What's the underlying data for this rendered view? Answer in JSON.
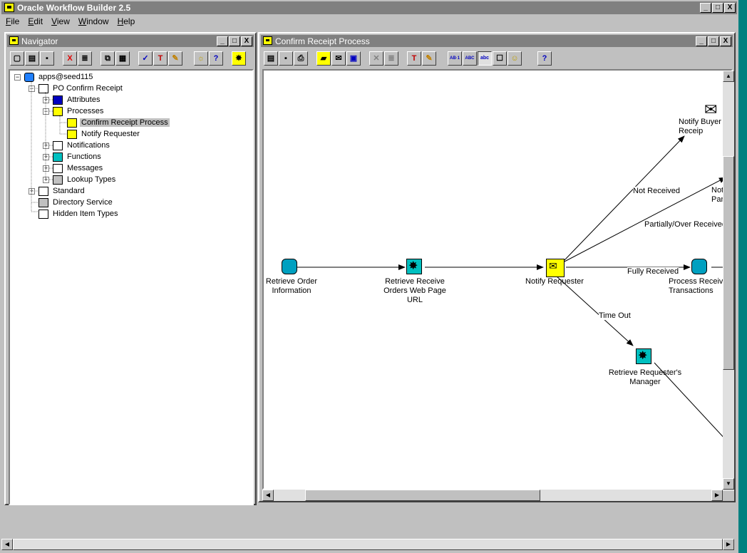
{
  "app": {
    "title": "Oracle Workflow Builder 2.5",
    "min": "_",
    "max": "□",
    "close": "X"
  },
  "menu": [
    {
      "label": "File",
      "key": "F",
      "rest": "ile"
    },
    {
      "label": "Edit",
      "key": "E",
      "rest": "dit"
    },
    {
      "label": "View",
      "key": "V",
      "rest": "iew"
    },
    {
      "label": "Window",
      "key": "W",
      "rest": "indow"
    },
    {
      "label": "Help",
      "key": "H",
      "rest": "elp"
    }
  ],
  "navigator": {
    "title": "Navigator",
    "tree": {
      "root": "apps@seed115",
      "item_type": "PO Confirm Receipt",
      "attributes": "Attributes",
      "processes": "Processes",
      "confirm_receipt_process": "Confirm Receipt Process",
      "notify_requester": "Notify Requester",
      "notifications": "Notifications",
      "functions": "Functions",
      "messages": "Messages",
      "lookup_types": "Lookup Types",
      "standard": "Standard",
      "directory_service": "Directory Service",
      "hidden_item_types": "Hidden Item Types"
    }
  },
  "process_window": {
    "title": "Confirm Receipt Process",
    "nodes": {
      "retrieve_order": "Retrieve Order\nInformation",
      "retrieve_url": "Retrieve Receive\nOrders Web Page\nURL",
      "notify_requester": "Notify Requester",
      "notify_buyer": "Notify Buyer o\nReceip",
      "notify_partial": "Not\nPart",
      "process_receive": "Process Receiv\nTransactions",
      "retrieve_manager": "Retrieve Requester's\nManager"
    },
    "transitions": {
      "not_received": "Not Received",
      "partially": "Partially/Over Received",
      "fully": "Fully Received",
      "timeout": "Time Out"
    }
  },
  "toolbar_glyphs": {
    "new": "▢",
    "open": "▤",
    "save": "▪",
    "delete": "X",
    "props": "≣",
    "copy": "⧉",
    "paste": "▦",
    "verify": "✓",
    "hammer": "T",
    "pencil": "✎",
    "bulb": "☼",
    "help": "?",
    "star": "✸",
    "print": "⎙",
    "proc": "▰",
    "notif": "✉",
    "func": "▣",
    "cut": "✕",
    "label1": "AB·1",
    "label2": "ABC",
    "label3": "abc",
    "bubble": "☐",
    "smile": "☺"
  },
  "scroll": {
    "up": "▲",
    "down": "▼",
    "left": "◀",
    "right": "▶"
  },
  "tree_toggles": {
    "collapse": "−",
    "expand": "+"
  }
}
